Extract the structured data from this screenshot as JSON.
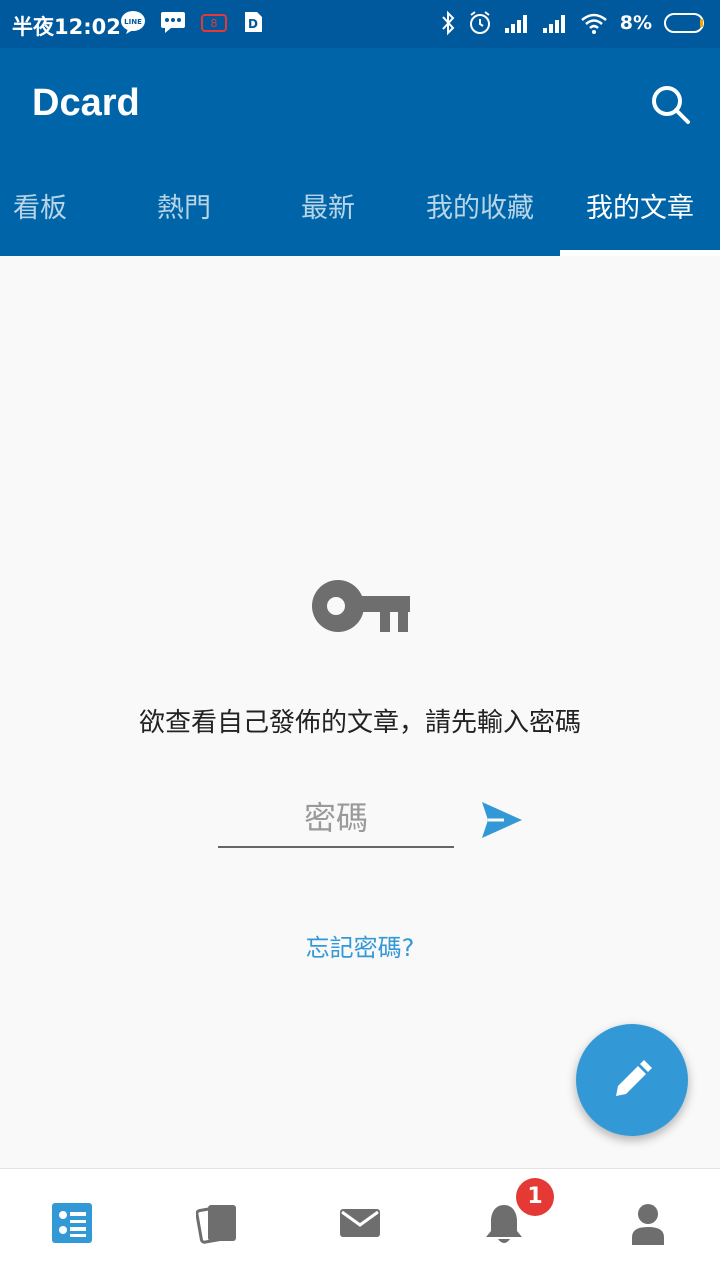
{
  "status_bar": {
    "time": "半夜12:02",
    "battery_percent": "8%",
    "left_icons": [
      "line-icon",
      "chat-icon",
      "tv-icon",
      "app-icon"
    ],
    "right_icons": [
      "bluetooth-icon",
      "alarm-icon",
      "signal-icon",
      "signal-icon",
      "wifi-icon",
      "battery-icon"
    ]
  },
  "appbar": {
    "title": "Dcard",
    "search_icon": "search-icon"
  },
  "tabs": [
    {
      "label": "看板"
    },
    {
      "label": "熱門"
    },
    {
      "label": "最新"
    },
    {
      "label": "我的收藏"
    },
    {
      "label": "我的文章",
      "active": true
    }
  ],
  "main": {
    "icon": "key-icon",
    "prompt": "欲查看自己發佈的文章，請先輸入密碼",
    "password_placeholder": "密碼",
    "send_icon": "send-icon",
    "forgot_link": "忘記密碼?"
  },
  "fab": {
    "icon": "pencil-icon"
  },
  "bottom_nav": {
    "items": [
      {
        "icon": "feed-icon",
        "active": true
      },
      {
        "icon": "cards-icon"
      },
      {
        "icon": "mail-icon"
      },
      {
        "icon": "bell-icon",
        "badge": "1"
      },
      {
        "icon": "person-icon"
      }
    ]
  },
  "colors": {
    "status_bar": "#00599c",
    "app_bar": "#0065a8",
    "accent": "#3399d6",
    "badge": "#e53935",
    "icon_gray": "#6e6e6e"
  }
}
